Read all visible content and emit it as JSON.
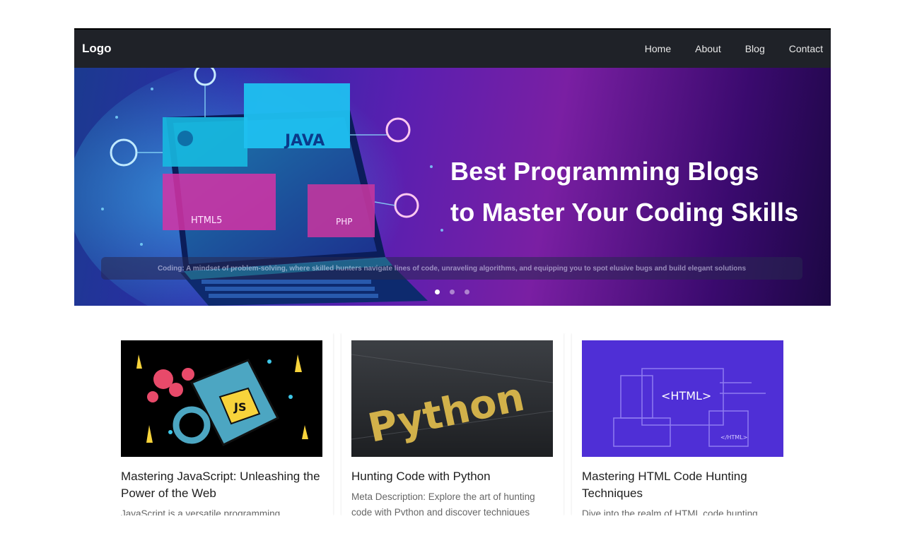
{
  "navbar": {
    "logo": "Logo",
    "links": [
      "Home",
      "About",
      "Blog",
      "Contact"
    ]
  },
  "hero": {
    "title_line1": "Best Programming Blogs",
    "title_line2": "to Master Your Coding Skills",
    "image_labels": {
      "java": "JAVA",
      "html5": "HTML5",
      "php": "PHP"
    },
    "caption": "Coding: A mindset of problem-solving, where skilled hunters navigate lines of code, unraveling algorithms, and equipping you to spot elusive bugs and build elegant solutions",
    "slides": 3,
    "active_slide": 1
  },
  "cards": [
    {
      "title": "Mastering JavaScript: Unleashing the Power of the Web",
      "description": "JavaScript is a versatile programming",
      "image_label": "JS"
    },
    {
      "title": "Hunting Code with Python",
      "description": "Meta Description: Explore the art of hunting code with Python and discover techniques",
      "image_label": "Python"
    },
    {
      "title": "Mastering HTML Code Hunting Techniques",
      "description": "Dive into the realm of HTML code hunting",
      "image_label": "<HTML>",
      "image_label_small": "</HTML>"
    }
  ],
  "colors": {
    "navbar_bg": "#1f2228",
    "hero_accent": "#7a1fa3",
    "html_card_bg": "#4f2fd6"
  }
}
